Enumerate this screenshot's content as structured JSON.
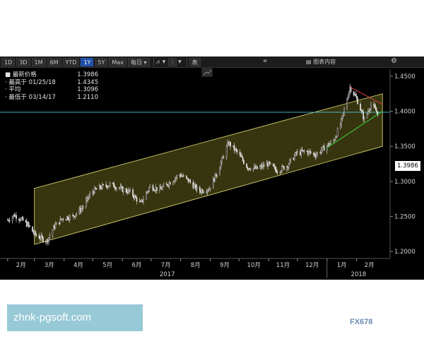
{
  "toolbar": {
    "periods": [
      "1D",
      "3D",
      "1M",
      "6M",
      "YTD",
      "1Y",
      "5Y",
      "Max"
    ],
    "active_period": "1Y",
    "frequency": "每日",
    "chart_icon": "line-chart-icon",
    "candle_icon": "candlestick-icon",
    "table_label": "表",
    "collapse_icon": "double-chevron-left-icon",
    "content_label": "图表内容",
    "settings_icon": "gear-icon"
  },
  "legend": {
    "rows": [
      {
        "label": "最新价格",
        "value": "1.3986"
      },
      {
        "label": "最高于 01/25/18",
        "value": "1.4345"
      },
      {
        "label": "平均",
        "value": "1.3096"
      },
      {
        "label": "最低于 03/14/17",
        "value": "1.2110"
      }
    ]
  },
  "last_price_tag": "1.3986",
  "watermark": "FX678",
  "banner_text": "zhnk-pgsoft.com",
  "colors": {
    "background": "#000000",
    "channel_fill": "#3d3a12",
    "channel_line": "#e8e27a",
    "price_line": "#4fc8e0",
    "candle": "#e8e8e8",
    "green_line": "#3cd23c",
    "red_line": "#e04040"
  },
  "chart_data": {
    "type": "candlestick",
    "x_ticks": [
      "2月",
      "3月",
      "4月",
      "5月",
      "6月",
      "7月",
      "8月",
      "9月",
      "10月",
      "11月",
      "12月",
      "1月",
      "2月"
    ],
    "x_year_labels": [
      "2017",
      "2018"
    ],
    "y_ticks": [
      "1.4500",
      "1.4000",
      "1.3500",
      "1.3000",
      "1.2500",
      "1.2000"
    ],
    "ylim": [
      1.19,
      1.46
    ],
    "last_price": 1.3986,
    "high": {
      "date": "01/25/18",
      "value": 1.4345
    },
    "average": 1.3096,
    "low": {
      "date": "03/14/17",
      "value": 1.211
    },
    "channel": {
      "upper": {
        "start": [
          "2017-03-01",
          1.29
        ],
        "end": [
          "2018-02-28",
          1.425
        ]
      },
      "lower": {
        "start": [
          "2017-03-01",
          1.21
        ],
        "end": [
          "2018-02-28",
          1.35
        ]
      }
    },
    "trend_support": {
      "start": [
        "2018-01-01",
        1.348
      ],
      "end": [
        "2018-02-28",
        1.4
      ]
    },
    "trend_resistance": {
      "start": [
        "2018-01-25",
        1.4345
      ],
      "end": [
        "2018-02-28",
        1.41
      ]
    },
    "price_path": [
      [
        "2017-02-01",
        1.245
      ],
      [
        "2017-02-08",
        1.252
      ],
      [
        "2017-02-15",
        1.246
      ],
      [
        "2017-02-22",
        1.238
      ],
      [
        "2017-03-01",
        1.225
      ],
      [
        "2017-03-08",
        1.219
      ],
      [
        "2017-03-14",
        1.215
      ],
      [
        "2017-03-22",
        1.236
      ],
      [
        "2017-03-31",
        1.248
      ],
      [
        "2017-04-10",
        1.25
      ],
      [
        "2017-04-20",
        1.262
      ],
      [
        "2017-04-30",
        1.285
      ],
      [
        "2017-05-10",
        1.292
      ],
      [
        "2017-05-20",
        1.296
      ],
      [
        "2017-05-31",
        1.289
      ],
      [
        "2017-06-10",
        1.284
      ],
      [
        "2017-06-20",
        1.268
      ],
      [
        "2017-06-30",
        1.293
      ],
      [
        "2017-07-10",
        1.288
      ],
      [
        "2017-07-20",
        1.298
      ],
      [
        "2017-07-31",
        1.31
      ],
      [
        "2017-08-10",
        1.3
      ],
      [
        "2017-08-20",
        1.286
      ],
      [
        "2017-08-31",
        1.29
      ],
      [
        "2017-09-08",
        1.312
      ],
      [
        "2017-09-20",
        1.355
      ],
      [
        "2017-09-30",
        1.34
      ],
      [
        "2017-10-10",
        1.32
      ],
      [
        "2017-10-20",
        1.318
      ],
      [
        "2017-10-31",
        1.325
      ],
      [
        "2017-11-10",
        1.315
      ],
      [
        "2017-11-20",
        1.322
      ],
      [
        "2017-11-30",
        1.34
      ],
      [
        "2017-12-10",
        1.343
      ],
      [
        "2017-12-20",
        1.338
      ],
      [
        "2017-12-31",
        1.35
      ],
      [
        "2018-01-08",
        1.358
      ],
      [
        "2018-01-16",
        1.385
      ],
      [
        "2018-01-25",
        1.4345
      ],
      [
        "2018-02-01",
        1.418
      ],
      [
        "2018-02-09",
        1.388
      ],
      [
        "2018-02-16",
        1.41
      ],
      [
        "2018-02-23",
        1.398
      ]
    ]
  }
}
